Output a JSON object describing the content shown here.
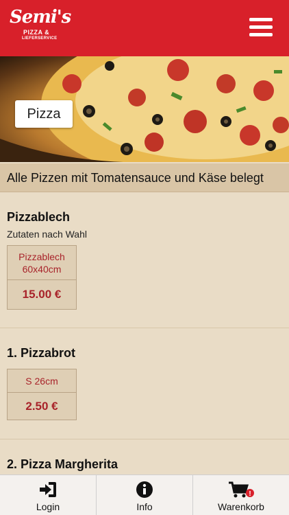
{
  "header": {
    "logo_script": "Semi's",
    "logo_line1": "PIZZA &",
    "logo_line2": "LIEFERSERVICE",
    "menu_icon": "hamburger-menu-icon",
    "brand_color": "#d8202a"
  },
  "hero": {
    "category_label": "Pizza"
  },
  "notice": "Alle Pizzen mit Tomatensauce und Käse belegt",
  "products": [
    {
      "name": "Pizzablech",
      "description": "Zutaten nach Wahl",
      "options": [
        {
          "size": "Pizzablech 60x40cm",
          "price": "15.00 €"
        }
      ]
    },
    {
      "name": "1. Pizzabrot",
      "description": "",
      "options": [
        {
          "size": "S 26cm",
          "price": "2.50 €"
        }
      ]
    },
    {
      "name": "2. Pizza Margherita",
      "description": "",
      "options": []
    }
  ],
  "bottom_nav": [
    {
      "label": "Login",
      "icon": "login-icon"
    },
    {
      "label": "Info",
      "icon": "info-icon"
    },
    {
      "label": "Warenkorb",
      "icon": "cart-icon",
      "badge": "!"
    }
  ],
  "colors": {
    "price_text": "#a8232a",
    "background": "#e9dcc6"
  }
}
